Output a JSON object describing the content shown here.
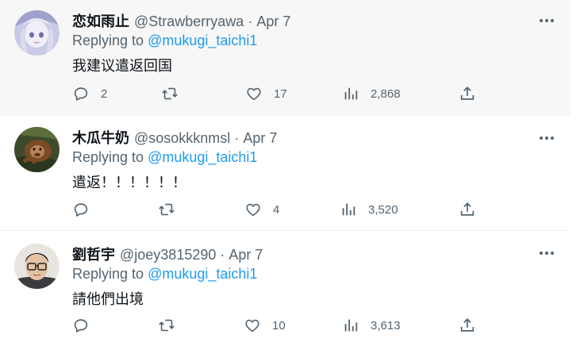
{
  "replies": [
    {
      "display_name": "恋如雨止",
      "handle": "@Strawberryawa",
      "separator": "·",
      "date": "Apr 7",
      "replying_prefix": "Replying to ",
      "replying_to": "@mukugi_taichi1",
      "text": "我建议遣返回国",
      "reply_count": "2",
      "repost_count": "",
      "like_count": "17",
      "view_count": "2,868"
    },
    {
      "display_name": "木瓜牛奶",
      "handle": "@sosokkknmsl",
      "separator": "·",
      "date": "Apr 7",
      "replying_prefix": "Replying to ",
      "replying_to": "@mukugi_taichi1",
      "text": "遣返！！！！！！",
      "reply_count": "",
      "repost_count": "",
      "like_count": "4",
      "view_count": "3,520"
    },
    {
      "display_name": "劉哲宇",
      "handle": "@joey3815290",
      "separator": "·",
      "date": "Apr 7",
      "replying_prefix": "Replying to ",
      "replying_to": "@mukugi_taichi1",
      "text": "請他們出境",
      "reply_count": "",
      "repost_count": "",
      "like_count": "10",
      "view_count": "3,613"
    }
  ],
  "colors": {
    "text_primary": "#0f1419",
    "text_secondary": "#536471",
    "link": "#1d9bf0",
    "hover_bg": "#f7f7f7",
    "divider": "#eff3f4"
  },
  "icons": [
    "more-icon",
    "reply-icon",
    "repost-icon",
    "like-icon",
    "views-icon",
    "share-icon"
  ]
}
